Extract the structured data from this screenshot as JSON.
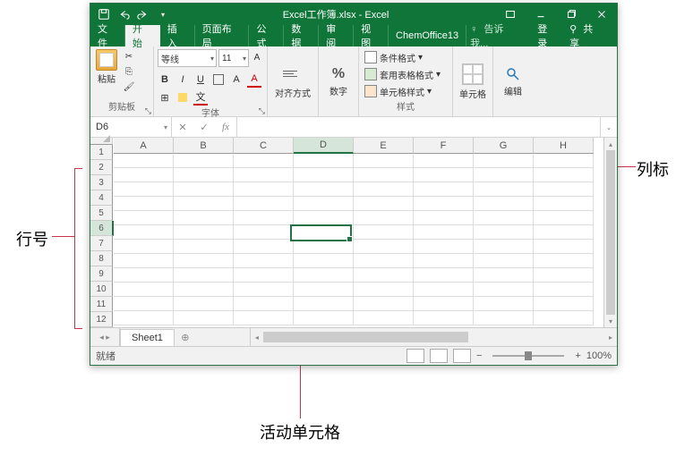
{
  "title": "Excel工作簿.xlsx - Excel",
  "menu": {
    "file": "文件",
    "home": "开始",
    "insert": "插入",
    "layout": "页面布局",
    "formulas": "公式",
    "data": "数据",
    "review": "审阅",
    "view": "视图",
    "chemoffice": "ChemOffice13",
    "tellme": "告诉我...",
    "signin": "登录",
    "share": "共享"
  },
  "ribbon": {
    "clipboard": "剪贴板",
    "paste": "粘贴",
    "font_group": "字体",
    "font_name": "等线",
    "font_size": "11",
    "align": "对齐方式",
    "number": "数字",
    "styles": "样式",
    "cond_fmt": "条件格式",
    "tbl_fmt": "套用表格格式",
    "cell_style": "单元格样式",
    "cells": "单元格",
    "editing": "编辑"
  },
  "namebox": "D6",
  "columns": [
    "A",
    "B",
    "C",
    "D",
    "E",
    "F",
    "G",
    "H"
  ],
  "rows": [
    "1",
    "2",
    "3",
    "4",
    "5",
    "6",
    "7",
    "8",
    "9",
    "10",
    "11",
    "12"
  ],
  "active": {
    "col": 3,
    "row": 5
  },
  "sheet": "Sheet1",
  "status": "就绪",
  "zoom": "100%",
  "annotations": {
    "row_label": "行号",
    "col_label": "列标",
    "cell_label": "活动单元格"
  }
}
